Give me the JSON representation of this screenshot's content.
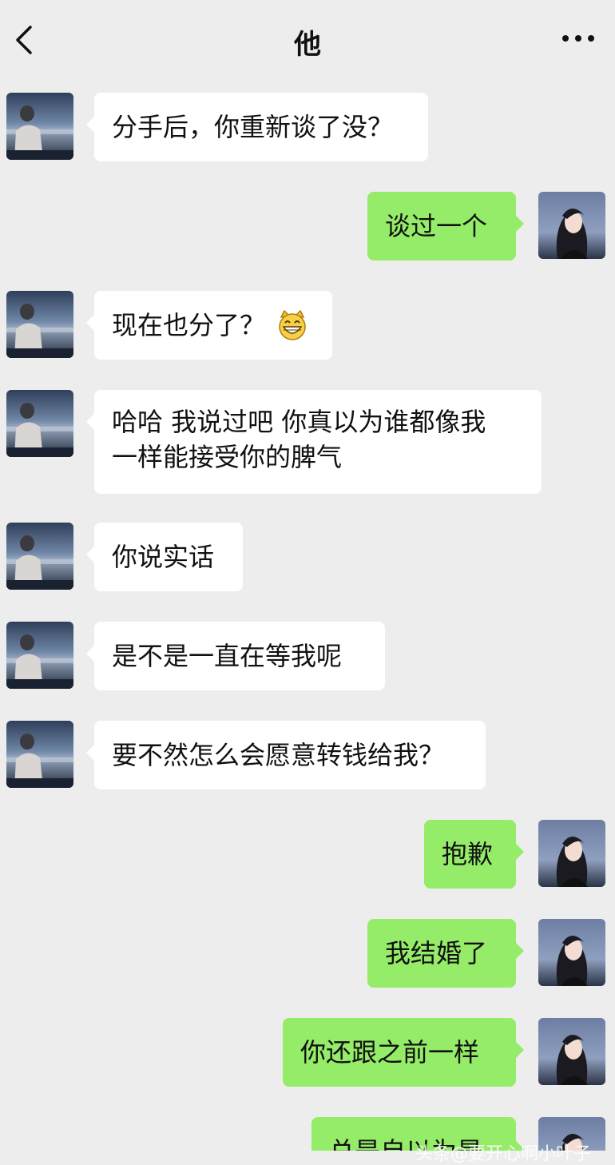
{
  "header": {
    "title": "他"
  },
  "messages": [
    {
      "side": "in",
      "text": "分手后，你重新谈了没？"
    },
    {
      "side": "out",
      "text": "谈过一个"
    },
    {
      "side": "in",
      "text": "现在也分了？",
      "emoji": "grinning-cat-emoji"
    },
    {
      "side": "in",
      "line1": "哈哈 我说过吧 你真以为谁都像我",
      "line2": "一样能接受你的脾气"
    },
    {
      "side": "in",
      "text": "你说实话"
    },
    {
      "side": "in",
      "text": "是不是一直在等我呢"
    },
    {
      "side": "in",
      "text": "要不然怎么会愿意转钱给我？"
    },
    {
      "side": "out",
      "text": "抱歉"
    },
    {
      "side": "out",
      "text": "我结婚了"
    },
    {
      "side": "out",
      "text": "你还跟之前一样"
    },
    {
      "side": "out",
      "text": "总是自以为是"
    }
  ],
  "watermark": "头条@要开心啊小叶子",
  "colors": {
    "background": "#ededed",
    "incoming_bubble": "#ffffff",
    "outgoing_bubble": "#95ec69"
  }
}
